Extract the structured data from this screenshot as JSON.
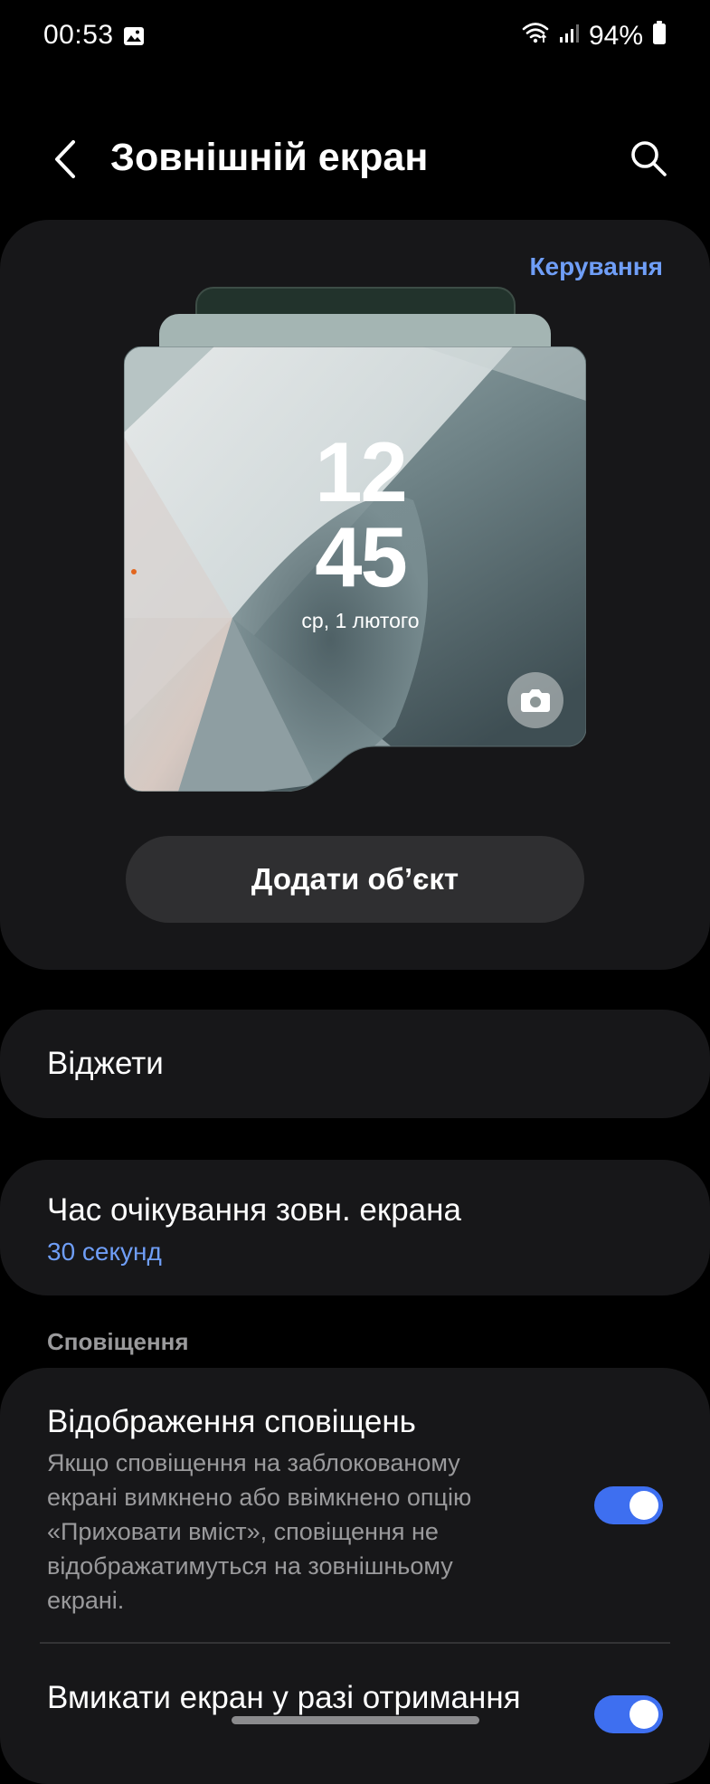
{
  "status_bar": {
    "time": "00:53",
    "battery": "94%"
  },
  "app_bar": {
    "title": "Зовнішній екран"
  },
  "preview": {
    "manage_label": "Керування",
    "clock_hour": "12",
    "clock_minute": "45",
    "clock_date": "ср, 1 лютого",
    "add_object_label": "Додати об’єкт"
  },
  "settings": {
    "widgets_label": "Віджети",
    "timeout_label": "Час очікування зовн. екрана",
    "timeout_value": "30 секунд",
    "notifications_header": "Сповіщення",
    "show_notifications_label": "Відображення сповіщень",
    "show_notifications_desc": "Якщо сповіщення на заблокованому екрані вимкнено або ввімкнено опцію «Приховати вміст», сповіщення не відображатимуться на зовнішньому екрані.",
    "show_notifications_on": true,
    "wake_screen_label": "Вмикати екран у разі отримання",
    "wake_screen_on": true
  },
  "colors": {
    "accent": "#3e6ff0",
    "link": "#6f9ef7",
    "card": "#171719",
    "background": "#000000"
  }
}
